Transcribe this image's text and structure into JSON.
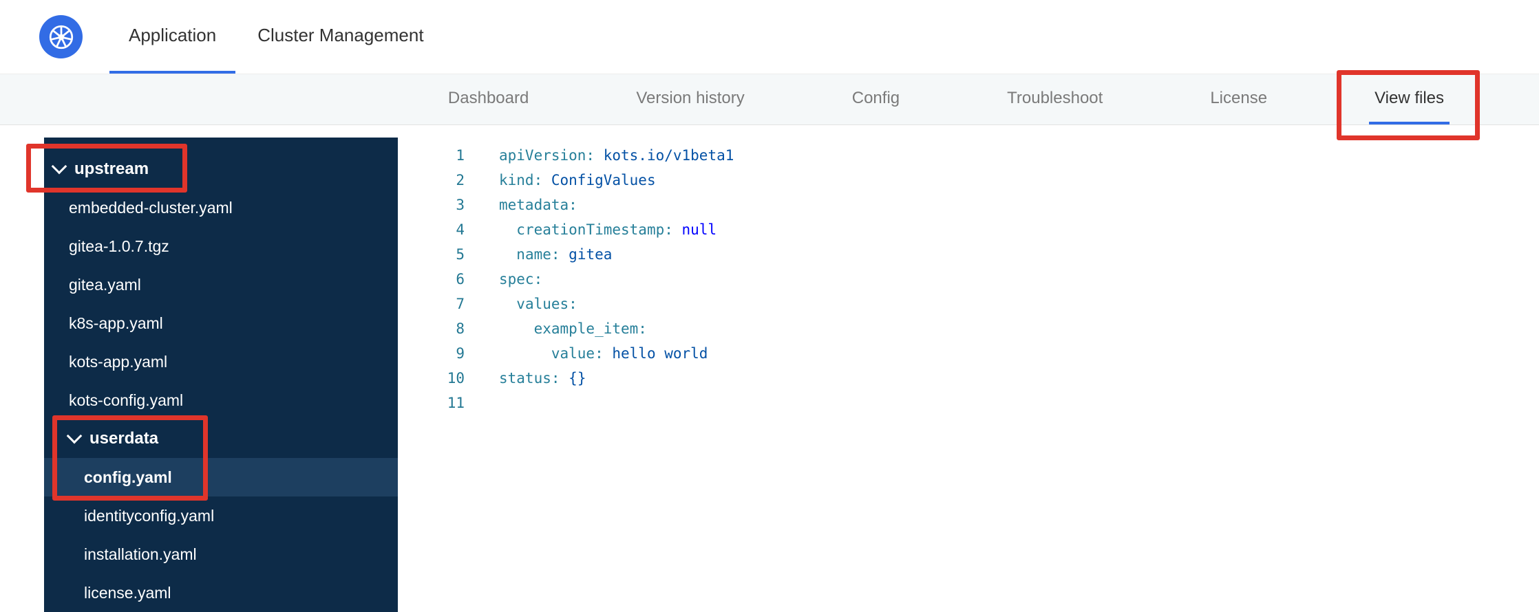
{
  "colors": {
    "accent_blue": "#326de6",
    "logo_blue": "#326ce5",
    "sidebar_bg": "#0d2b48",
    "sidebar_selected_bg": "#1d3f60",
    "annotation_red": "#e0352b",
    "yaml_key": "#267f99",
    "yaml_value": "#0451a5",
    "yaml_keyword": "#0000ff",
    "line_number": "#237893"
  },
  "header": {
    "logo_icon": "kubernetes-wheel-icon",
    "tabs": [
      {
        "label": "Application",
        "active": true
      },
      {
        "label": "Cluster Management",
        "active": false
      }
    ]
  },
  "subnav": {
    "tabs": [
      {
        "label": "Dashboard",
        "active": false,
        "annotated": false
      },
      {
        "label": "Version history",
        "active": false,
        "annotated": false
      },
      {
        "label": "Config",
        "active": false,
        "annotated": false
      },
      {
        "label": "Troubleshoot",
        "active": false,
        "annotated": false
      },
      {
        "label": "License",
        "active": false,
        "annotated": false
      },
      {
        "label": "View files",
        "active": true,
        "annotated": true
      }
    ]
  },
  "file_tree": {
    "items": [
      {
        "label": "upstream",
        "kind": "folder",
        "level": 0,
        "expanded": true,
        "selected": false,
        "annotated": true
      },
      {
        "label": "embedded-cluster.yaml",
        "kind": "file",
        "level": 1,
        "selected": false
      },
      {
        "label": "gitea-1.0.7.tgz",
        "kind": "file",
        "level": 1,
        "selected": false
      },
      {
        "label": "gitea.yaml",
        "kind": "file",
        "level": 1,
        "selected": false
      },
      {
        "label": "k8s-app.yaml",
        "kind": "file",
        "level": 1,
        "selected": false
      },
      {
        "label": "kots-app.yaml",
        "kind": "file",
        "level": 1,
        "selected": false
      },
      {
        "label": "kots-config.yaml",
        "kind": "file",
        "level": 1,
        "selected": false
      },
      {
        "label": "userdata",
        "kind": "folder",
        "level": 1,
        "expanded": true,
        "selected": false,
        "annotated": true
      },
      {
        "label": "config.yaml",
        "kind": "file",
        "level": 2,
        "selected": true,
        "annotated": true
      },
      {
        "label": "identityconfig.yaml",
        "kind": "file",
        "level": 2,
        "selected": false
      },
      {
        "label": "installation.yaml",
        "kind": "file",
        "level": 2,
        "selected": false
      },
      {
        "label": "license.yaml",
        "kind": "file",
        "level": 2,
        "selected": false
      }
    ]
  },
  "editor": {
    "open_file": "config.yaml",
    "lines": [
      {
        "num": 1,
        "tokens": [
          [
            "key",
            "apiVersion:"
          ],
          [
            "plain",
            " "
          ],
          [
            "val",
            "kots.io/v1beta1"
          ]
        ]
      },
      {
        "num": 2,
        "tokens": [
          [
            "key",
            "kind:"
          ],
          [
            "plain",
            " "
          ],
          [
            "val",
            "ConfigValues"
          ]
        ]
      },
      {
        "num": 3,
        "tokens": [
          [
            "key",
            "metadata:"
          ]
        ]
      },
      {
        "num": 4,
        "tokens": [
          [
            "plain",
            "  "
          ],
          [
            "key",
            "creationTimestamp:"
          ],
          [
            "plain",
            " "
          ],
          [
            "kw",
            "null"
          ]
        ]
      },
      {
        "num": 5,
        "tokens": [
          [
            "plain",
            "  "
          ],
          [
            "key",
            "name:"
          ],
          [
            "plain",
            " "
          ],
          [
            "val",
            "gitea"
          ]
        ]
      },
      {
        "num": 6,
        "tokens": [
          [
            "key",
            "spec:"
          ]
        ]
      },
      {
        "num": 7,
        "tokens": [
          [
            "plain",
            "  "
          ],
          [
            "key",
            "values:"
          ]
        ]
      },
      {
        "num": 8,
        "tokens": [
          [
            "plain",
            "    "
          ],
          [
            "key",
            "example_item:"
          ]
        ]
      },
      {
        "num": 9,
        "tokens": [
          [
            "plain",
            "      "
          ],
          [
            "key",
            "value:"
          ],
          [
            "plain",
            " "
          ],
          [
            "val",
            "hello world"
          ]
        ]
      },
      {
        "num": 10,
        "tokens": [
          [
            "key",
            "status:"
          ],
          [
            "plain",
            " "
          ],
          [
            "val",
            "{}"
          ]
        ]
      },
      {
        "num": 11,
        "tokens": []
      }
    ]
  },
  "annotations": [
    {
      "target": "upstream-folder"
    },
    {
      "target": "userdata-config-yaml"
    },
    {
      "target": "view-files-tab"
    }
  ]
}
